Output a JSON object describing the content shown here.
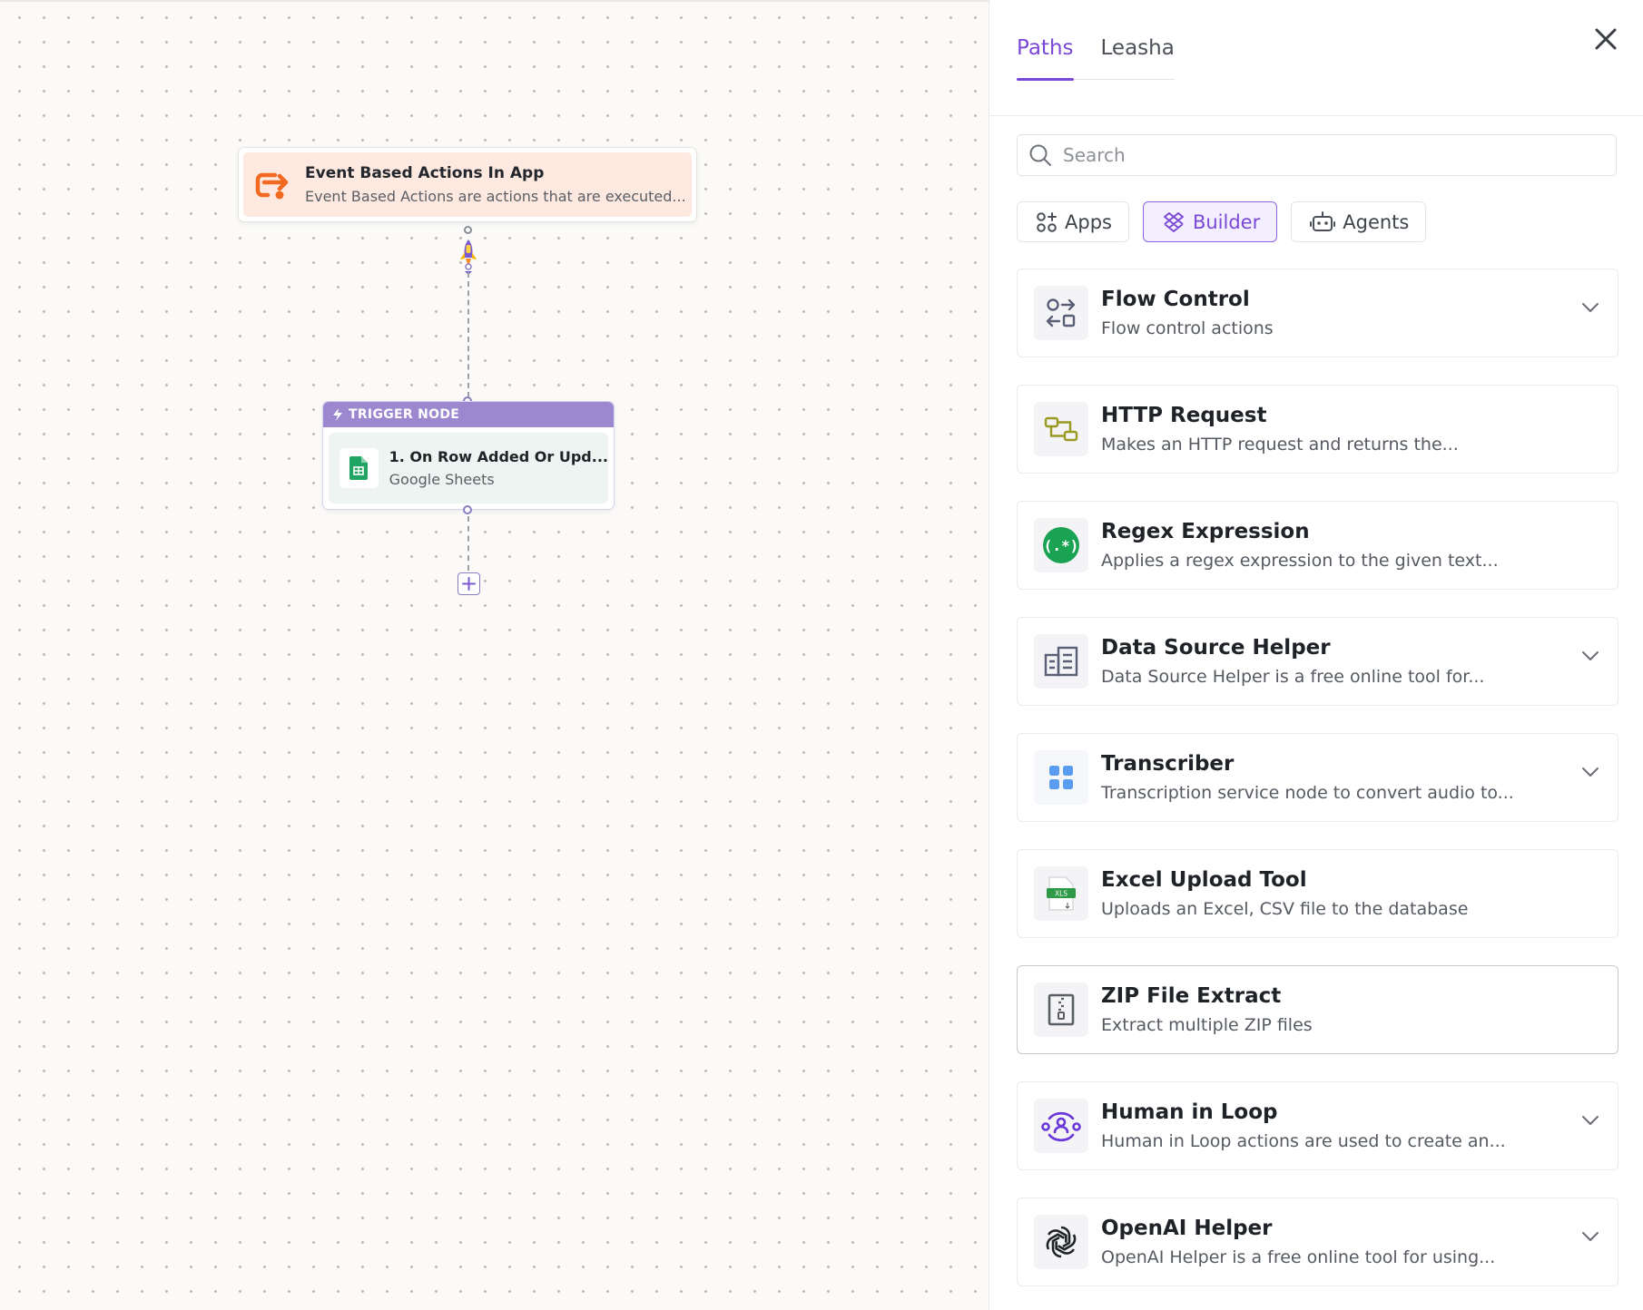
{
  "canvas": {
    "event_node": {
      "title": "Event Based Actions In App",
      "subtitle": "Event Based Actions are actions that are executed..."
    },
    "trigger_node": {
      "header": "TRIGGER NODE",
      "title": "1. On Row Added Or Upd...",
      "subtitle": "Google Sheets"
    }
  },
  "panel": {
    "tabs": [
      {
        "label": "Paths",
        "active": true
      },
      {
        "label": "Leasha",
        "active": false
      }
    ],
    "search": {
      "placeholder": "Search",
      "value": ""
    },
    "filters": [
      {
        "label": "Apps",
        "icon": "apps-icon",
        "active": false
      },
      {
        "label": "Builder",
        "icon": "builder-icon",
        "active": true
      },
      {
        "label": "Agents",
        "icon": "agent-robot-icon",
        "active": false
      }
    ],
    "items": [
      {
        "title": "Flow Control",
        "description": "Flow control actions",
        "icon": "flow-control-icon",
        "expandable": true
      },
      {
        "title": "HTTP Request",
        "description": "Makes an HTTP request and returns the...",
        "icon": "http-request-icon",
        "expandable": false
      },
      {
        "title": "Regex Expression",
        "description": "Applies a regex expression to the given text...",
        "icon": "regex-icon",
        "expandable": false
      },
      {
        "title": "Data Source Helper",
        "description": "Data Source Helper is a free online tool for...",
        "icon": "data-source-icon",
        "expandable": true
      },
      {
        "title": "Transcriber",
        "description": "Transcription service node to convert audio to...",
        "icon": "transcriber-icon",
        "expandable": true
      },
      {
        "title": "Excel Upload Tool",
        "description": "Uploads an Excel, CSV file to the database",
        "icon": "excel-file-icon",
        "expandable": false
      },
      {
        "title": "ZIP File Extract",
        "description": "Extract multiple ZIP files",
        "icon": "zip-file-icon",
        "expandable": false,
        "selected": true
      },
      {
        "title": "Human in Loop",
        "description": "Human in Loop actions are used to create an...",
        "icon": "human-in-loop-icon",
        "expandable": true
      },
      {
        "title": "OpenAI Helper",
        "description": "OpenAI Helper is a free online tool for using...",
        "icon": "openai-icon",
        "expandable": true
      }
    ]
  },
  "colors": {
    "accent": "#7a48d6",
    "trigger_header": "#9b88cf",
    "event_bg": "#fde9e0",
    "event_icon": "#f26a21"
  }
}
